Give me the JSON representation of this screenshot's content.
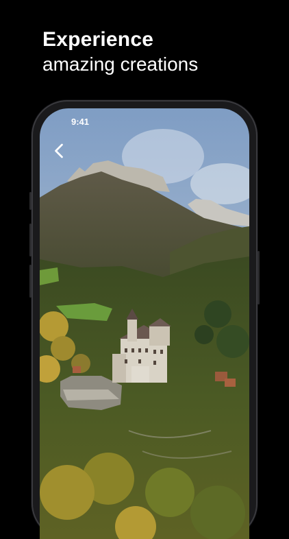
{
  "headline": {
    "title": "Experience",
    "subtitle": "amazing creations"
  },
  "status_bar": {
    "time": "9:41",
    "icons": [
      "cellular-signal-icon",
      "wifi-icon",
      "battery-icon"
    ]
  },
  "navigation": {
    "back_icon": "chevron-left-icon"
  },
  "colors": {
    "background": "#000000",
    "text": "#ffffff",
    "phone_frame": "#1a1a1c"
  }
}
